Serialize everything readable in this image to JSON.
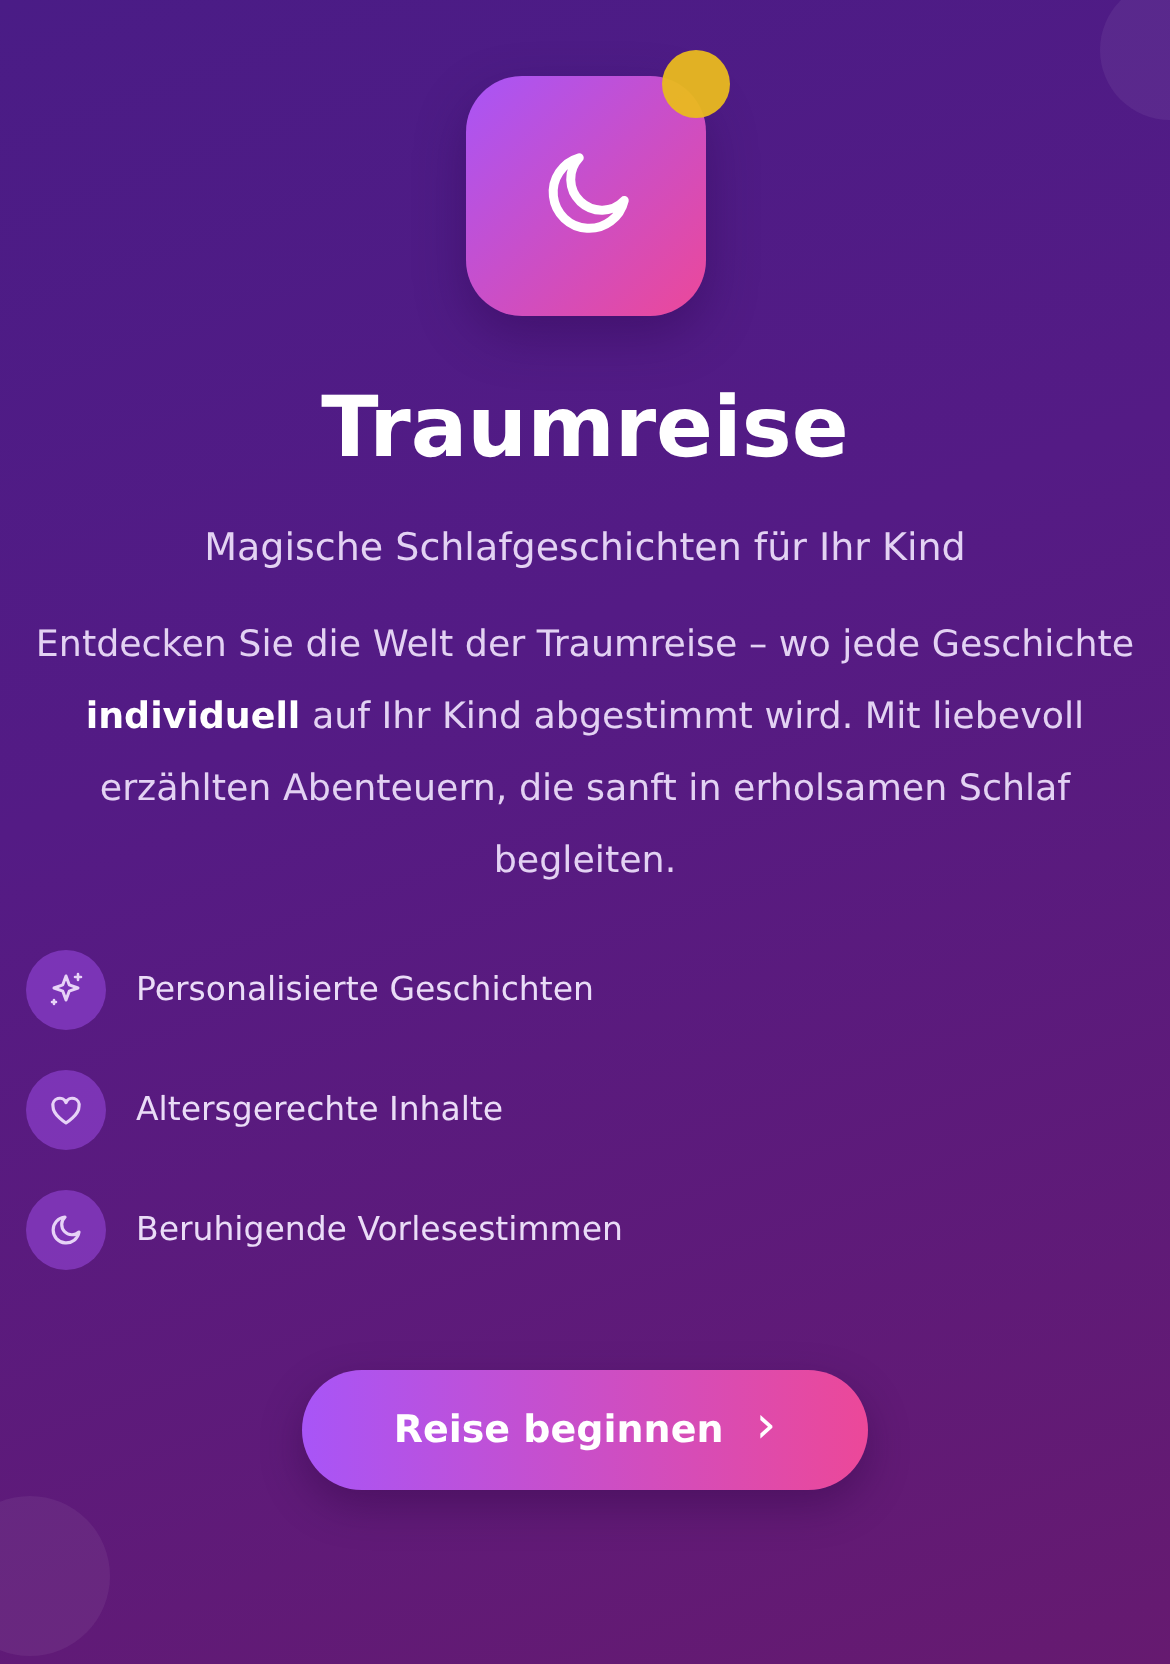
{
  "app": {
    "title": "Traumreise",
    "subtitle": "Magische Schlafgeschichten für Ihr Kind",
    "badge": {
      "shown": true,
      "color": "#e9b91f"
    }
  },
  "description": "Entdecken Sie die Welt der Traumreise – wo jede Geschichte **individuell** auf Ihr Kind abgestimmt wird. Mit liebevoll erzählten Abenteuern, die sanft in erholsamen Schlaf begleiten.",
  "features": [
    {
      "kind": "sparkle",
      "label": "Personalisierte Geschichten"
    },
    {
      "kind": "heart",
      "label": "Altersgerechte Inhalte"
    },
    {
      "kind": "moon",
      "label": "Beruhigende Vorlesestimmen"
    }
  ],
  "button": {
    "label": "Reise beginnen",
    "icon": "›"
  }
}
